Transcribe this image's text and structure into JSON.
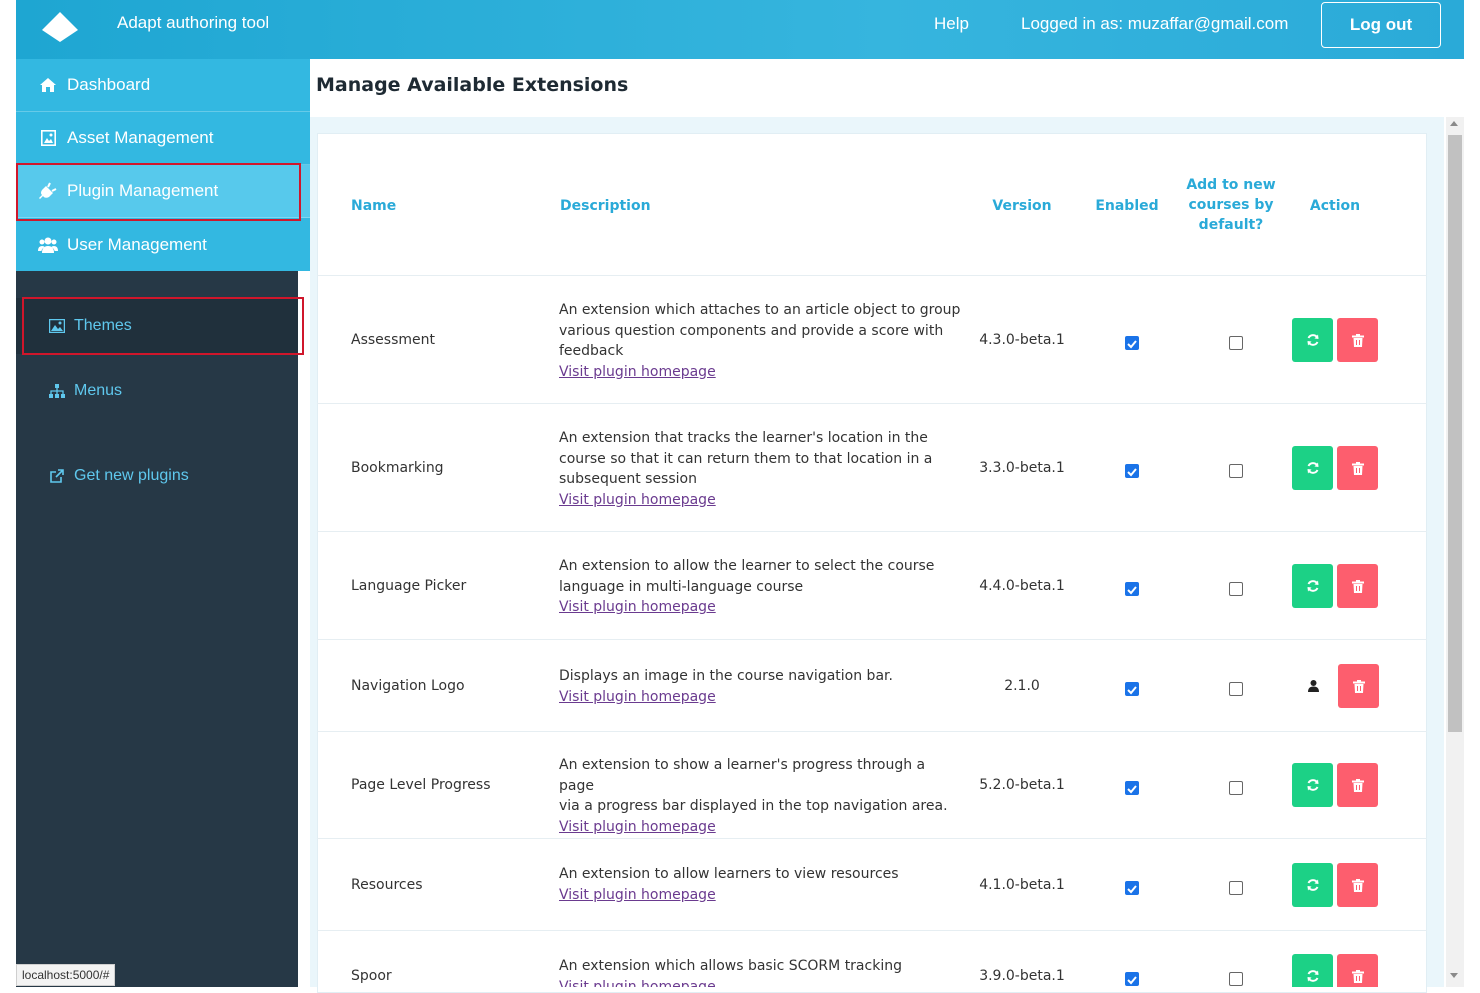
{
  "header": {
    "app_title": "Adapt authoring tool",
    "help": "Help",
    "logged_in": "Logged in as: muzaffar@gmail.com",
    "logout": "Log out"
  },
  "dropdown": {
    "items": [
      {
        "label": "Dashboard",
        "icon": "home-icon"
      },
      {
        "label": "Asset Management",
        "icon": "image-file-icon"
      },
      {
        "label": "Plugin Management",
        "icon": "plug-icon",
        "active": true
      },
      {
        "label": "User Management",
        "icon": "users-icon"
      }
    ]
  },
  "sidebar": {
    "items": [
      {
        "label": "Themes",
        "icon": "picture-icon"
      },
      {
        "label": "Menus",
        "icon": "sitemap-icon"
      },
      {
        "label": "Get new plugins",
        "icon": "external-link-icon"
      }
    ]
  },
  "status_url": "localhost:5000/#",
  "page": {
    "title": "Manage Available Extensions"
  },
  "table": {
    "headers": {
      "name": "Name",
      "description": "Description",
      "version": "Version",
      "enabled": "Enabled",
      "default_line1": "Add to new",
      "default_line2": "courses by",
      "default_line3": "default?",
      "action": "Action"
    },
    "link_text": "Visit plugin homepage",
    "rows": [
      {
        "name": "Assessment",
        "desc": [
          "An extension which attaches to an article object to group",
          "various question components and provide a score with",
          "feedback"
        ],
        "version": "4.3.0-beta.1",
        "enabled": true,
        "default": false,
        "action": "update"
      },
      {
        "name": "Bookmarking",
        "desc": [
          "An extension that tracks the learner's location in the",
          "course so that it can return them to that location in a",
          "subsequent session"
        ],
        "version": "3.3.0-beta.1",
        "enabled": true,
        "default": false,
        "action": "update"
      },
      {
        "name": "Language Picker",
        "desc": [
          "An extension to allow the learner to select the course",
          "language in multi-language course"
        ],
        "version": "4.4.0-beta.1",
        "enabled": true,
        "default": false,
        "action": "update"
      },
      {
        "name": "Navigation Logo",
        "desc": [
          "Displays an image in the course navigation bar."
        ],
        "version": "2.1.0",
        "enabled": true,
        "default": false,
        "action": "user"
      },
      {
        "name": "Page Level Progress",
        "desc": [
          "An extension to show a learner's progress through a page",
          "via a progress bar displayed in the top navigation area."
        ],
        "version": "5.2.0-beta.1",
        "enabled": true,
        "default": false,
        "action": "update"
      },
      {
        "name": "Resources",
        "desc": [
          "An extension to allow learners to view resources"
        ],
        "version": "4.1.0-beta.1",
        "enabled": true,
        "default": false,
        "action": "update"
      },
      {
        "name": "Spoor",
        "desc": [
          "An extension which allows basic SCORM tracking"
        ],
        "version": "3.9.0-beta.1",
        "enabled": true,
        "default": false,
        "action": "update"
      }
    ]
  },
  "colors": {
    "topbar": "#2aaad8",
    "sidebar": "#263846",
    "dropdown": "#33b8e1",
    "accent": "#2aaad8",
    "green": "#1cd186",
    "red": "#fd5e6e",
    "highlight": "#d0162b"
  }
}
